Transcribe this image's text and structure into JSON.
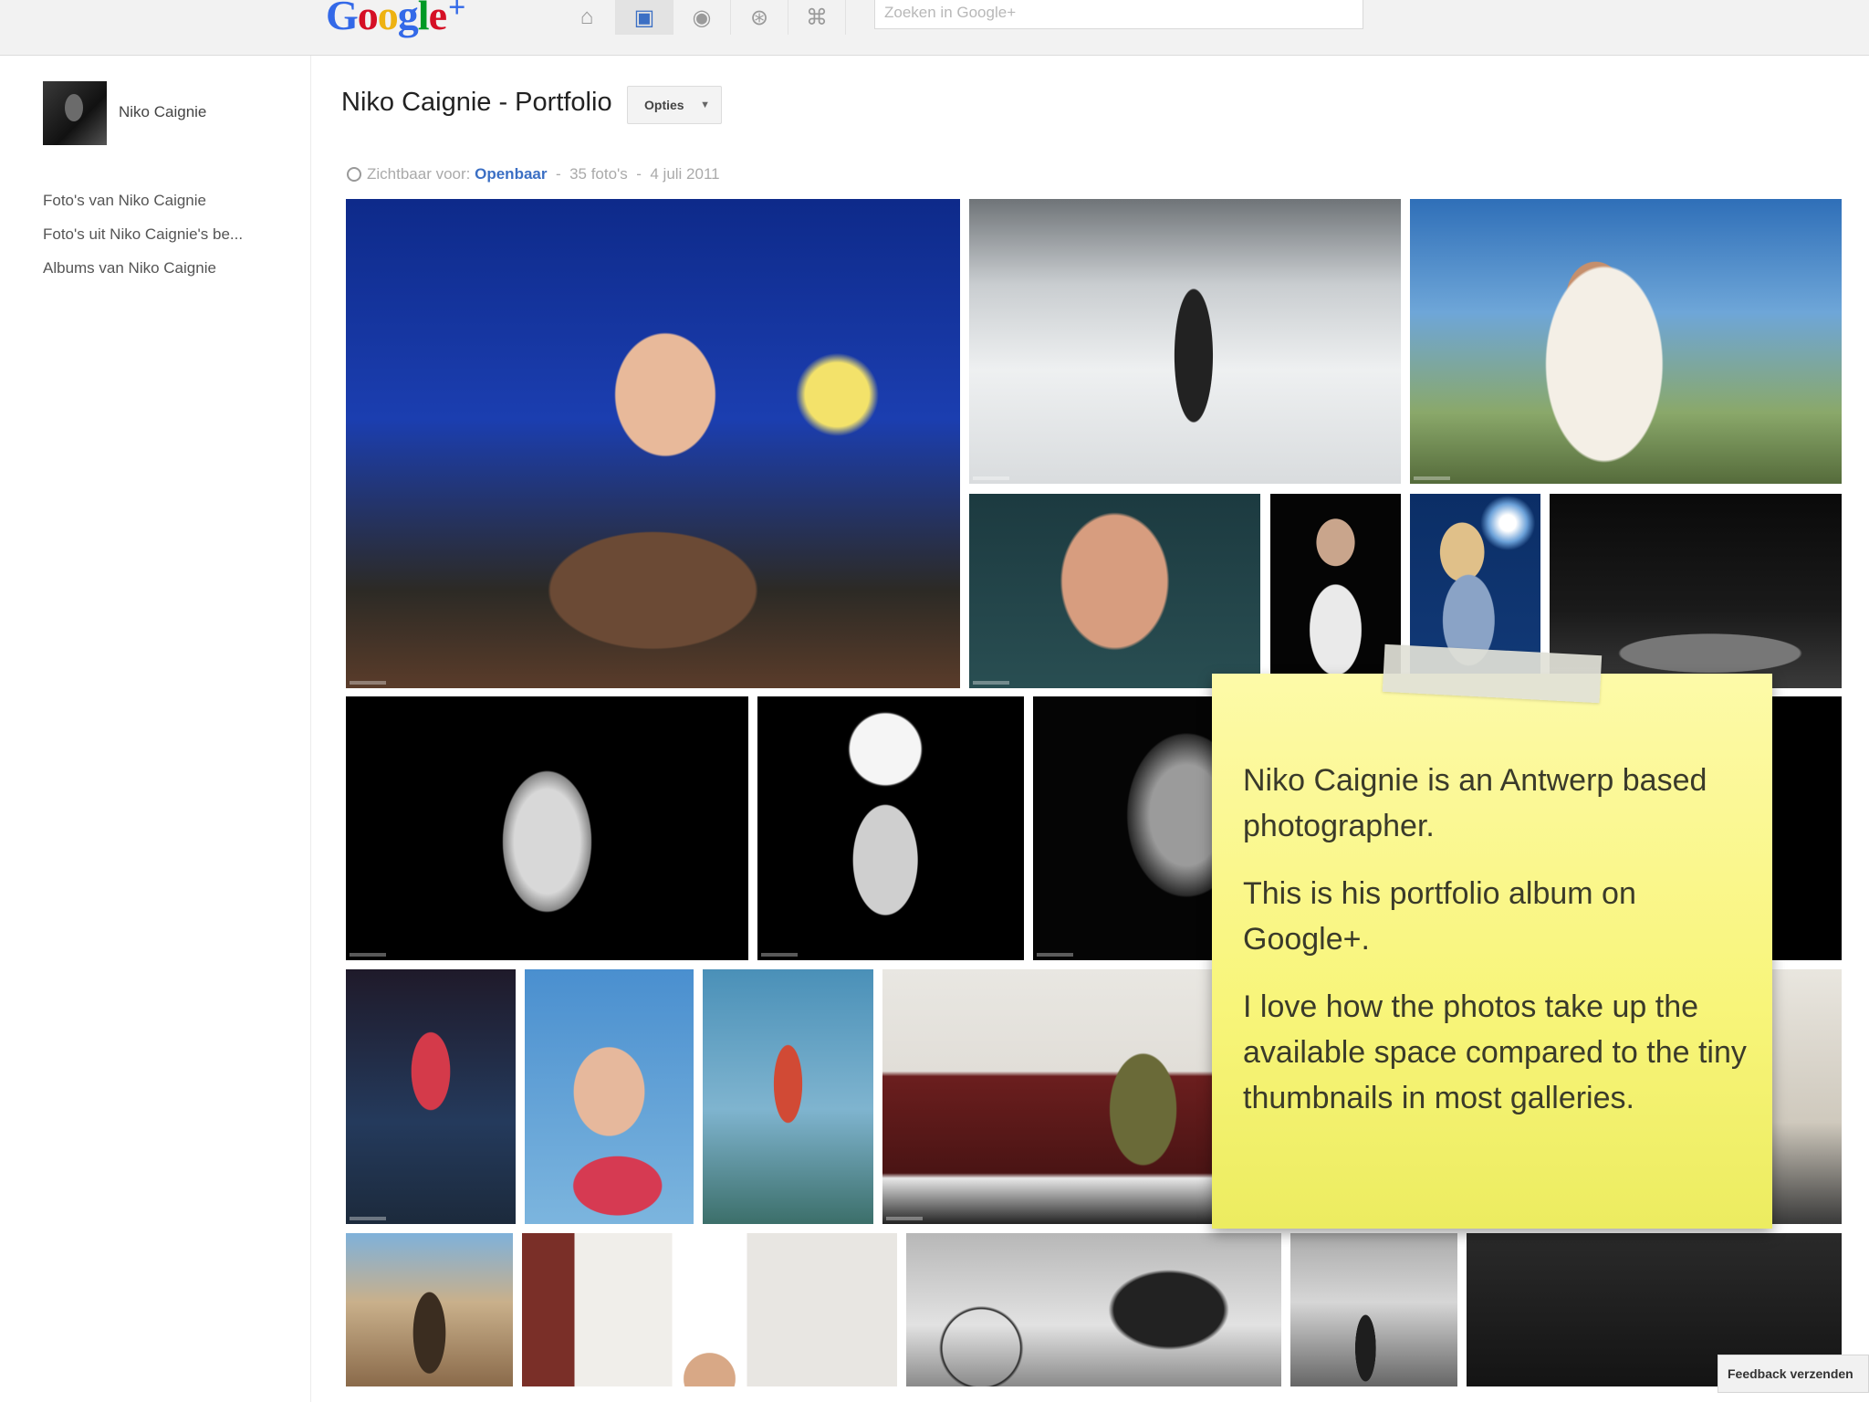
{
  "topbar": {
    "logo": {
      "G": "G",
      "o1": "o",
      "o2": "o",
      "g": "g",
      "l": "l",
      "e": "e",
      "plus": "+"
    },
    "nav_icons": [
      "home-icon",
      "photos-icon",
      "profile-icon",
      "circles-icon",
      "games-icon"
    ],
    "active_nav": "photos-icon",
    "search_placeholder": "Zoeken in Google+"
  },
  "sidebar": {
    "profile_name": "Niko Caignie",
    "links": [
      {
        "label": "Foto's van Niko Caignie"
      },
      {
        "label": "Foto's uit Niko Caignie's be..."
      },
      {
        "label": "Albums van Niko Caignie"
      }
    ]
  },
  "album": {
    "title": "Niko Caignie - Portfolio",
    "options_label": "Opties",
    "visibility_label": "Zichtbaar voor:",
    "visibility_value": "Openbaar",
    "photo_count": "35 foto's",
    "date": "4 juli 2011",
    "separator": "-"
  },
  "note": {
    "paragraphs": [
      "Niko Caignie is an Antwerp based photographer.",
      "This is his portfolio album on Google+.",
      "I love how the photos take up the available space compared to the tiny thumbnails in most galleries."
    ]
  },
  "feedback_label": "Feedback verzenden",
  "colors": {
    "accent": "#3b6fc4",
    "note_yellow": "#f8f57a",
    "topbar": "#f2f2f2"
  }
}
